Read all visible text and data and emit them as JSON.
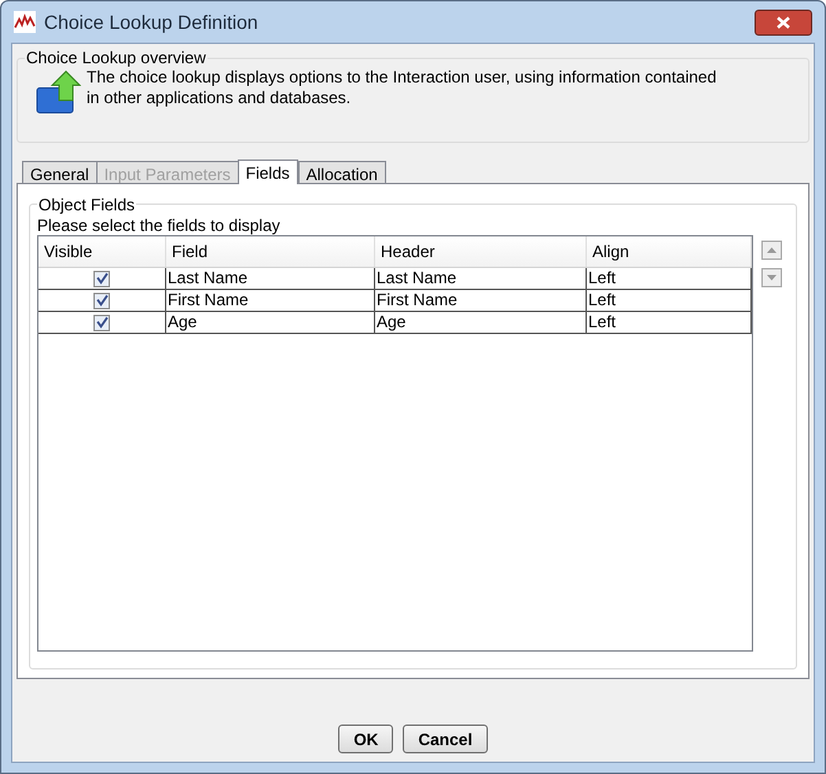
{
  "window": {
    "title": "Choice Lookup Definition"
  },
  "overview": {
    "title": "Choice Lookup overview",
    "description": "The choice lookup displays options to the Interaction user, using information contained in other applications and databases."
  },
  "tabs": [
    {
      "label": "General",
      "selected": false,
      "disabled": false
    },
    {
      "label": "Input Parameters",
      "selected": false,
      "disabled": true
    },
    {
      "label": "Fields",
      "selected": true,
      "disabled": false
    },
    {
      "label": "Allocation",
      "selected": false,
      "disabled": false
    }
  ],
  "object_fields": {
    "title": "Object Fields",
    "instruction": "Please select the fields to display",
    "columns": [
      "Visible",
      "Field",
      "Header",
      "Align"
    ],
    "rows": [
      {
        "visible": true,
        "field": "Last Name",
        "header": "Last Name",
        "align": "Left"
      },
      {
        "visible": true,
        "field": "First Name",
        "header": "First Name",
        "align": "Left"
      },
      {
        "visible": true,
        "field": "Age",
        "header": "Age",
        "align": "Left"
      }
    ]
  },
  "buttons": [
    {
      "label": "OK"
    },
    {
      "label": "Cancel"
    }
  ]
}
